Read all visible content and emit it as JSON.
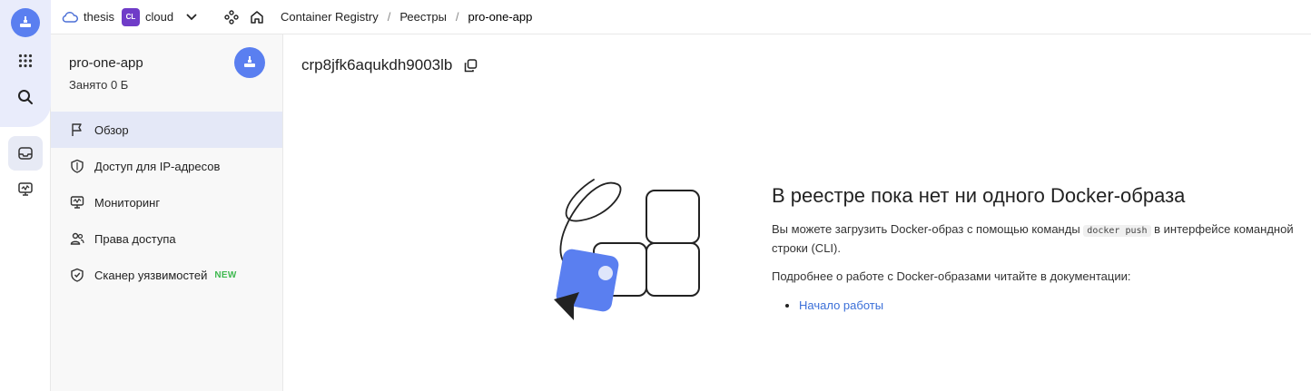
{
  "topbar": {
    "cloud_name": "thesis",
    "cloud_badge": "CL",
    "folder_name": "cloud",
    "breadcrumbs": [
      {
        "label": "Container Registry"
      },
      {
        "label": "Реестры"
      },
      {
        "label": "pro-one-app"
      }
    ],
    "separator": "/"
  },
  "sidebar": {
    "title": "pro-one-app",
    "subtitle": "Занято 0 Б",
    "items": [
      {
        "label": "Обзор",
        "icon": "flag-icon",
        "active": true
      },
      {
        "label": "Доступ для IP-адресов",
        "icon": "shield-icon",
        "active": false
      },
      {
        "label": "Мониторинг",
        "icon": "monitor-icon",
        "active": false
      },
      {
        "label": "Права доступа",
        "icon": "users-icon",
        "active": false
      },
      {
        "label": "Сканер уязвимостей",
        "icon": "shield-check-icon",
        "active": false,
        "badge": "NEW"
      }
    ]
  },
  "main": {
    "registry_id": "crp8jfk6aqukdh9003lb",
    "empty_state": {
      "title": "В реестре пока нет ни одного Docker-образа",
      "text_before": "Вы можете загрузить Docker-образ с помощью команды",
      "command": "docker push",
      "text_after": "в интерфейсе командной строки (CLI).",
      "more_text": "Подробнее о работе с Docker-образами читайте в документации:",
      "links": [
        {
          "label": "Начало работы"
        }
      ]
    }
  },
  "colors": {
    "accent": "#5a7ff0",
    "link": "#3b6fd8",
    "badge_new": "#3fb950",
    "cloud_badge": "#6f3cc8"
  }
}
